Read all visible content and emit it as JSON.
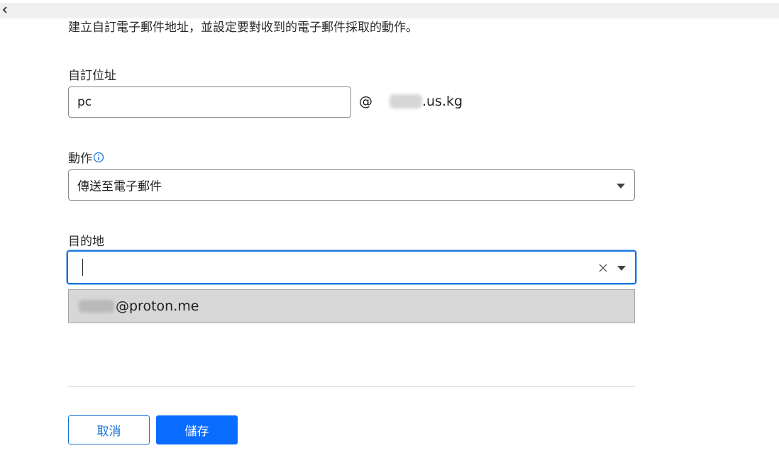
{
  "header": {
    "back_icon": "chevron-left-icon"
  },
  "intro_text": "建立自訂電子郵件地址，並設定要對收到的電子郵件採取的動作。",
  "custom_address": {
    "label": "自訂位址",
    "value": "pc",
    "at_symbol": "@",
    "domain_suffix": ".us.kg"
  },
  "action": {
    "label": "動作",
    "info_icon": "info-icon",
    "selected": "傳送至電子郵件"
  },
  "destination": {
    "label": "目的地",
    "value": "",
    "options": [
      {
        "email_suffix": "@proton.me"
      }
    ]
  },
  "buttons": {
    "cancel_label": "取消",
    "save_label": "儲存"
  },
  "colors": {
    "accent": "#0a6cff",
    "focus_border": "#1a73d9",
    "option_bg": "#d7d7d7"
  }
}
